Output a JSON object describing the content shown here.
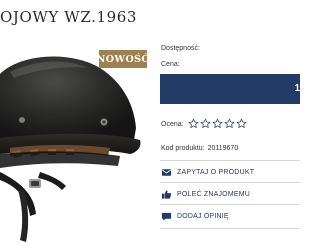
{
  "product": {
    "title": "OJOWY WZ.1963",
    "badge": "NOWOŚĆ",
    "helmet_image_icon": "helmet-image",
    "availability_label": "Dostępność:",
    "price_label": "Cena:",
    "cart_glyph": "1",
    "rating_label": "Ocena:",
    "rating_stars_filled": 0,
    "rating_stars_total": 5,
    "code_label": "Kod produktu:",
    "code_value": "20119670"
  },
  "actions": [
    {
      "label": "ZAPYTAJ O PRODUKT",
      "icon": "envelope-icon"
    },
    {
      "label": "POLEĆ ZNAJOMEMU",
      "icon": "thumbs-up-icon"
    },
    {
      "label": "DODAJ OPINIĘ",
      "icon": "speech-bubble-icon"
    }
  ],
  "colors": {
    "accent": "#223b67",
    "badge": "#9f8050",
    "star_outline": "#223b67"
  }
}
